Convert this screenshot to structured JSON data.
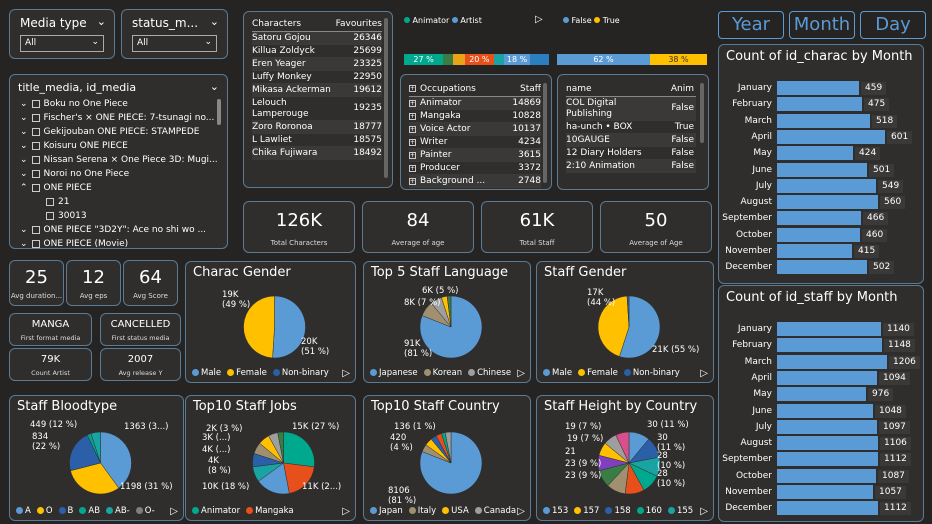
{
  "slicers": {
    "media_type": {
      "label": "Media type",
      "value": "All"
    },
    "status": {
      "label": "status_m...",
      "value": "All"
    }
  },
  "tree": {
    "title": "title_media, id_media",
    "items": [
      {
        "text": "Boku no One Piece",
        "ind": 0,
        "ex": "v"
      },
      {
        "text": "Fischer's × ONE PIECE: 7-tsunagi no...",
        "ind": 0,
        "ex": "v"
      },
      {
        "text": "Gekijouban ONE PIECE: STAMPEDE",
        "ind": 0,
        "ex": "v"
      },
      {
        "text": "Koisuru ONE PIECE",
        "ind": 0,
        "ex": "v"
      },
      {
        "text": "Nissan Serena × One Piece 3D: Mugi...",
        "ind": 0,
        "ex": "v"
      },
      {
        "text": "Noroi no One Piece",
        "ind": 0,
        "ex": "v"
      },
      {
        "text": "ONE PIECE",
        "ind": 0,
        "ex": "^"
      },
      {
        "text": "21",
        "ind": 1,
        "ex": ""
      },
      {
        "text": "30013",
        "ind": 1,
        "ex": ""
      },
      {
        "text": "ONE PIECE \"3D2Y\": Ace no shi wo ...",
        "ind": 0,
        "ex": "v"
      },
      {
        "text": "ONE PIECE (Movie)",
        "ind": 0,
        "ex": "v"
      }
    ]
  },
  "characters": {
    "headers": [
      "Characters",
      "Favourites"
    ],
    "rows": [
      [
        "Satoru Gojou",
        "26346"
      ],
      [
        "Killua Zoldyck",
        "25699"
      ],
      [
        "Eren Yeager",
        "23325"
      ],
      [
        "Luffy Monkey",
        "22950"
      ],
      [
        "Mikasa Ackerman",
        "19612"
      ],
      [
        "Lelouch Lamperouge",
        "19235"
      ],
      [
        "Zoro Roronoa",
        "18777"
      ],
      [
        "L Lawliet",
        "18575"
      ],
      [
        "Chika Fujiwara",
        "18492"
      ]
    ]
  },
  "top_legend": {
    "a": "Animator",
    "b": "Artist",
    "c": "False",
    "d": "True"
  },
  "stack1": [
    {
      "label": "27 %",
      "w": 27,
      "color": "#00a88e"
    },
    {
      "label": "",
      "w": 7,
      "color": "#3a7d44"
    },
    {
      "label": "",
      "w": 8,
      "color": "#e8a317"
    },
    {
      "label": "20 %",
      "w": 20,
      "color": "#e8501b"
    },
    {
      "label": "",
      "w": 7,
      "color": "#1aa3a3"
    },
    {
      "label": "18 %",
      "w": 18,
      "color": "#5b9bd5"
    },
    {
      "label": "",
      "w": 13,
      "color": "#2b7fbf"
    }
  ],
  "stack2": [
    {
      "label": "62 %",
      "w": 62,
      "color": "#5b9bd5"
    },
    {
      "label": "38 %",
      "w": 38,
      "color": "#ffc000"
    }
  ],
  "occupations": {
    "headers": [
      "Occupations",
      "Staff"
    ],
    "rows": [
      [
        "Animator",
        "14869"
      ],
      [
        "Mangaka",
        "10828"
      ],
      [
        "Voice Actor",
        "10137"
      ],
      [
        "Writer",
        "4234"
      ],
      [
        "Painter",
        "3615"
      ],
      [
        "Producer",
        "3372"
      ],
      [
        "Background ...",
        "2748"
      ]
    ]
  },
  "studios": {
    "headers": [
      "name",
      "Anim"
    ],
    "rows": [
      [
        "COL Digital Publishing",
        "False"
      ],
      [
        "ha-unch • BOX",
        "True"
      ],
      [
        "10GAUGE",
        "False"
      ],
      [
        "12 Diary Holders",
        "False"
      ],
      [
        "2:10 Animation",
        "False"
      ]
    ]
  },
  "kpis": [
    {
      "value": "126K",
      "label": "Total Characters"
    },
    {
      "value": "84",
      "label": "Average of age"
    },
    {
      "value": "61K",
      "label": "Total Staff"
    },
    {
      "value": "50",
      "label": "Average of Age"
    }
  ],
  "small_kpis": [
    {
      "value": "25",
      "label": "Avg duration..."
    },
    {
      "value": "12",
      "label": "Avg eps"
    },
    {
      "value": "64",
      "label": "Avg Score"
    }
  ],
  "text_kpis": [
    {
      "value": "MANGA",
      "label": "First format media"
    },
    {
      "value": "CANCELLED",
      "label": "First status media"
    },
    {
      "value": "79K",
      "label": "Count Artist"
    },
    {
      "value": "2007",
      "label": "Avg release Y"
    }
  ],
  "buttons": [
    "Year",
    "Month",
    "Day"
  ],
  "charac_month": {
    "title": "Count of id_charac by Month",
    "rows": [
      [
        "January",
        459
      ],
      [
        "February",
        475
      ],
      [
        "March",
        518
      ],
      [
        "April",
        601
      ],
      [
        "May",
        424
      ],
      [
        "June",
        501
      ],
      [
        "July",
        549
      ],
      [
        "August",
        560
      ],
      [
        "September",
        466
      ],
      [
        "October",
        460
      ],
      [
        "November",
        415
      ],
      [
        "December",
        502
      ]
    ],
    "max": 601
  },
  "staff_month": {
    "title": "Count of id_staff by Month",
    "rows": [
      [
        "January",
        1140
      ],
      [
        "February",
        1148
      ],
      [
        "March",
        1206
      ],
      [
        "April",
        1094
      ],
      [
        "May",
        976
      ],
      [
        "June",
        1048
      ],
      [
        "July",
        1097
      ],
      [
        "August",
        1106
      ],
      [
        "September",
        1112
      ],
      [
        "October",
        1087
      ],
      [
        "November",
        1057
      ],
      [
        "December",
        1112
      ]
    ],
    "max": 1206
  },
  "pies": [
    {
      "title": "Charac Gender",
      "slices": [
        {
          "v": 51,
          "c": "#5b9bd5"
        },
        {
          "v": 49,
          "c": "#ffc000"
        }
      ],
      "labels": [
        "19K\n(49 %)",
        "20K\n(51 %)"
      ],
      "legend": [
        [
          "Male",
          "#5b9bd5"
        ],
        [
          "Female",
          "#ffc000"
        ],
        [
          "Non-binary",
          "#2b5fa8"
        ]
      ]
    },
    {
      "title": "Top 5 Staff Language",
      "slices": [
        {
          "v": 81,
          "c": "#5b9bd5"
        },
        {
          "v": 8,
          "c": "#a09070"
        },
        {
          "v": 6,
          "c": "#9e9e9e"
        },
        {
          "v": 3,
          "c": "#ffc000"
        },
        {
          "v": 2,
          "c": "#3a7d44"
        }
      ],
      "labels": [
        "6K (5 %)",
        "8K (7 %)",
        "91K\n(81 %)"
      ],
      "legend": [
        [
          "Japanese",
          "#5b9bd5"
        ],
        [
          "Korean",
          "#a09070"
        ],
        [
          "Chinese",
          "#9e9e9e"
        ]
      ]
    },
    {
      "title": "Staff Gender",
      "slices": [
        {
          "v": 55,
          "c": "#5b9bd5"
        },
        {
          "v": 44,
          "c": "#ffc000"
        },
        {
          "v": 1,
          "c": "#2b5fa8"
        }
      ],
      "labels": [
        "17K\n(44 %)",
        "21K (55 %)"
      ],
      "legend": [
        [
          "Male",
          "#5b9bd5"
        ],
        [
          "Female",
          "#ffc000"
        ],
        [
          "Non-binary",
          "#2b5fa8"
        ]
      ]
    },
    {
      "title": "Staff Bloodtype",
      "slices": [
        {
          "v": 40,
          "c": "#5b9bd5"
        },
        {
          "v": 31,
          "c": "#ffc000"
        },
        {
          "v": 22,
          "c": "#2b5fa8"
        },
        {
          "v": 2,
          "c": "#00a88e"
        },
        {
          "v": 5,
          "c": "#1aa3a3"
        }
      ],
      "labels": [
        "449 (12 %)",
        "834\n(22 %)",
        "1363 (3...)",
        "1198 (31 %)"
      ],
      "legend": [
        [
          "A",
          "#5b9bd5"
        ],
        [
          "O",
          "#ffc000"
        ],
        [
          "B",
          "#2b5fa8"
        ],
        [
          "AB",
          "#00a88e"
        ],
        [
          "AB-",
          "#1aa3a3"
        ],
        [
          "O-",
          "#7f7f7f"
        ]
      ]
    },
    {
      "title": "Top10 Staff Jobs",
      "slices": [
        {
          "v": 27,
          "c": "#00a88e"
        },
        {
          "v": 20,
          "c": "#e8501b"
        },
        {
          "v": 18,
          "c": "#5b9bd5"
        },
        {
          "v": 8,
          "c": "#1aa3a3"
        },
        {
          "v": 7,
          "c": "#2b5fa8"
        },
        {
          "v": 6,
          "c": "#a09070"
        },
        {
          "v": 6,
          "c": "#ffc000"
        },
        {
          "v": 5,
          "c": "#9e9e9e"
        },
        {
          "v": 3,
          "c": "#3a7d44"
        }
      ],
      "labels": [
        "2K (3 %)",
        "3K (...)",
        "4K (...)",
        "4K\n(8 %)",
        "10K (18 %)",
        "15K (27 %)",
        "11K (2...)"
      ],
      "legend": [
        [
          "Animator",
          "#00a88e"
        ],
        [
          "Mangaka",
          "#e8501b"
        ]
      ]
    },
    {
      "title": "Top10 Staff Country",
      "slices": [
        {
          "v": 81,
          "c": "#5b9bd5"
        },
        {
          "v": 4,
          "c": "#a09070"
        },
        {
          "v": 4,
          "c": "#ffc000"
        },
        {
          "v": 3,
          "c": "#2b5fa8"
        },
        {
          "v": 3,
          "c": "#e8501b"
        },
        {
          "v": 2,
          "c": "#00a88e"
        },
        {
          "v": 3,
          "c": "#9e9e9e"
        }
      ],
      "labels": [
        "136 (1 %)",
        "420\n(4 %)",
        "8106\n(81 %)"
      ],
      "legend": [
        [
          "Japan",
          "#5b9bd5"
        ],
        [
          "Italy",
          "#a09070"
        ],
        [
          "USA",
          "#ffc000"
        ],
        [
          "Canada",
          "#9e9e9e"
        ]
      ]
    },
    {
      "title": "Staff Height by Country",
      "slices": [
        {
          "v": 11,
          "c": "#5b9bd5"
        },
        {
          "v": 11,
          "c": "#2b5fa8"
        },
        {
          "v": 10,
          "c": "#1aa3a3"
        },
        {
          "v": 10,
          "c": "#00a88e"
        },
        {
          "v": 10,
          "c": "#e8501b"
        },
        {
          "v": 10,
          "c": "#a09070"
        },
        {
          "v": 9,
          "c": "#3a7d44"
        },
        {
          "v": 8,
          "c": "#7f3fbf"
        },
        {
          "v": 7,
          "c": "#ffc000"
        },
        {
          "v": 7,
          "c": "#9e9e9e"
        },
        {
          "v": 7,
          "c": "#d94f8a"
        }
      ],
      "labels": [
        "19 (7 %)",
        "19 (7 %)",
        "21",
        "23 (9 %)",
        "23 (9 %)",
        "30 (11 %)",
        "30\n(11 %)",
        "28\n(10 %)",
        "28\n(10 %)"
      ],
      "legend": [
        [
          "153",
          "#5b9bd5"
        ],
        [
          "157",
          "#ffc000"
        ],
        [
          "158",
          "#2b5fa8"
        ],
        [
          "160",
          "#00a88e"
        ],
        [
          "155",
          "#1aa3a3"
        ]
      ]
    }
  ]
}
